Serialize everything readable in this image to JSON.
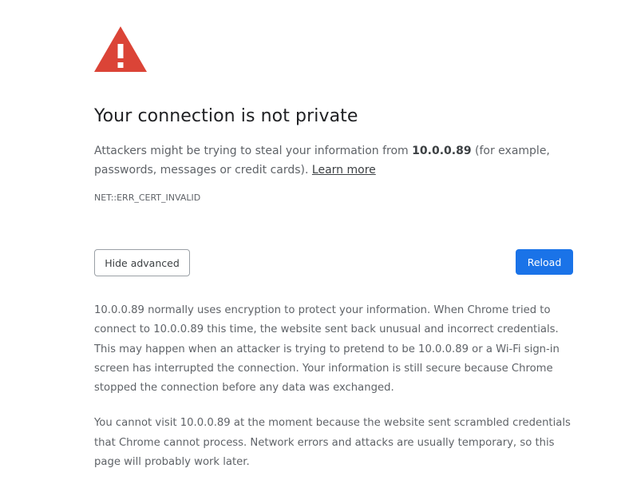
{
  "warning_icon": {
    "name": "warning-triangle-icon",
    "color": "#db4437"
  },
  "title": "Your connection is not private",
  "explanation": {
    "prefix": "Attackers might be trying to steal your information from ",
    "host": "10.0.0.89",
    "suffix": " (for example, passwords, messages or credit cards). ",
    "learn_more": "Learn more"
  },
  "error_code": "NET::ERR_CERT_INVALID",
  "buttons": {
    "advanced_label": "Hide advanced",
    "reload_label": "Reload",
    "reload_color": "#1a73e8"
  },
  "details": {
    "paragraph_1": "10.0.0.89 normally uses encryption to protect your information. When Chrome tried to connect to 10.0.0.89 this time, the website sent back unusual and incorrect credentials. This may happen when an attacker is trying to pretend to be 10.0.0.89 or a Wi-Fi sign-in screen has interrupted the connection. Your information is still secure because Chrome stopped the connection before any data was exchanged.",
    "paragraph_2": "You cannot visit 10.0.0.89 at the moment because the website sent scrambled credentials that Chrome cannot process. Network errors and attacks are usually temporary, so this page will probably work later."
  }
}
